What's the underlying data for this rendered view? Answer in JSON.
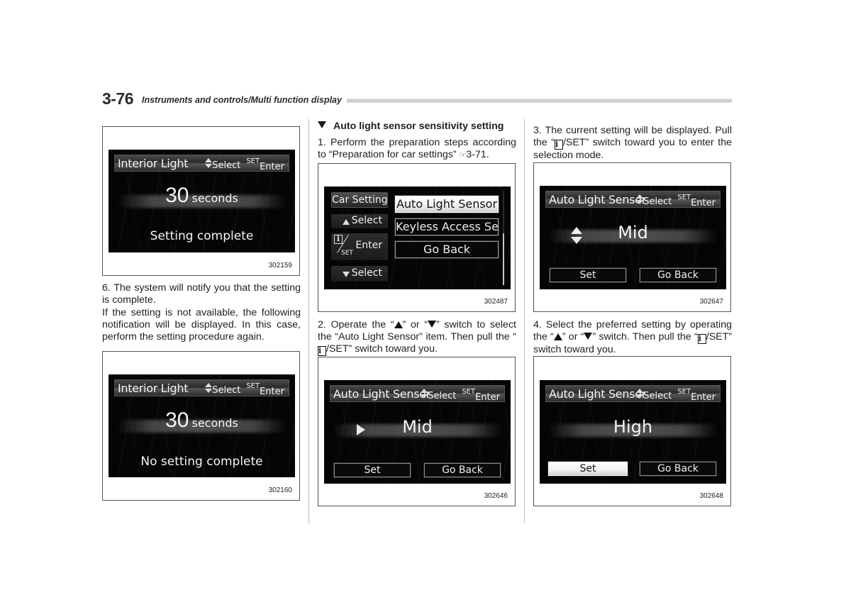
{
  "header": {
    "page_number": "3-76",
    "section_title": "Instruments and controls/Multi function display"
  },
  "column1": {
    "figure1": {
      "screen_title": "Interior Light",
      "hint_select": "Select",
      "hint_set": "SET",
      "hint_enter": "Enter",
      "value_number": "30",
      "value_unit": "seconds",
      "status": "Setting complete",
      "figure_code": "302159"
    },
    "step6": "6.  The system will notify you that the setting is complete.",
    "note": "If the setting is not available, the following notification will be displayed. In this case, perform the setting procedure again.",
    "figure2": {
      "screen_title": "Interior Light",
      "hint_select": "Select",
      "hint_set": "SET",
      "hint_enter": "Enter",
      "value_number": "30",
      "value_unit": "seconds",
      "status": "No setting complete",
      "figure_code": "302160"
    }
  },
  "column2": {
    "heading": "Auto light sensor sensitivity setting",
    "step1_text": "1.  Perform the preparation steps according to “Preparation for car settings”",
    "step1_ref": "3-71.",
    "ref_icon": "☞",
    "figure3": {
      "side_title": "Car Setting",
      "side_select_up": "Select",
      "side_enter": "Enter",
      "side_set": "SET",
      "side_select_down": "Select",
      "menu_items": [
        "Auto Light Sensor",
        "Keyless Access Sett",
        "Go Back"
      ],
      "selected_index": 0,
      "scroll_position": 0.55,
      "figure_code": "302487"
    },
    "step2_a": "2.  Operate the “",
    "step2_b": "” or “",
    "step2_c": "” switch to select the “Auto Light Sensor” item. Then pull the “",
    "step2_d": "/SET” switch toward you.",
    "figure4": {
      "screen_title": "Auto Light Sensor",
      "hint_select": "Select",
      "hint_set": "SET",
      "hint_enter": "Enter",
      "value": "Mid",
      "button_set": "Set",
      "button_back": "Go Back",
      "figure_code": "302646"
    }
  },
  "column3": {
    "step3_a": "3.  The current setting will be displayed. Pull the “",
    "step3_b": "/SET” switch toward you to enter the selection mode.",
    "figure5": {
      "screen_title": "Auto Light Sensor",
      "hint_select": "Select",
      "hint_set": "SET",
      "hint_enter": "Enter",
      "value": "Mid",
      "button_set": "Set",
      "button_back": "Go Back",
      "figure_code": "302647"
    },
    "step4_a": "4.  Select the preferred setting by operating the “",
    "step4_b": "” or “",
    "step4_c": "” switch. Then pull the “",
    "step4_d": "/SET” switch toward you.",
    "figure6": {
      "screen_title": "Auto Light Sensor",
      "hint_select": "Select",
      "hint_set": "SET",
      "hint_enter": "Enter",
      "value": "High",
      "button_set": "Set",
      "button_back": "Go Back",
      "figure_code": "302648"
    }
  },
  "icons": {
    "info_glyph": "i"
  }
}
